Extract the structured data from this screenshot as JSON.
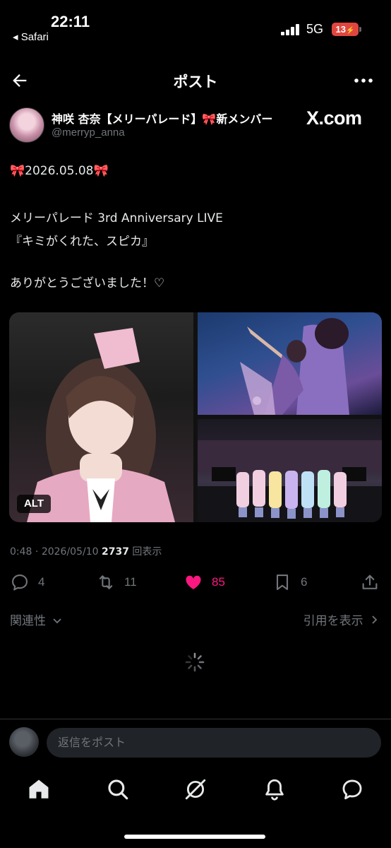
{
  "status": {
    "time": "22:11",
    "back_app": "◂ Safari",
    "network": "5G",
    "battery": "13"
  },
  "header": {
    "title": "ポスト"
  },
  "author": {
    "name": "神咲 杏奈【メリーパレード】🎀新メンバー",
    "handle": "@merryp_anna",
    "source": "X.com"
  },
  "post": {
    "line1": "🎀2026.05.08🎀",
    "line2": "メリーパレード 3rd Anniversary LIVE",
    "line3": "『キミがくれた、スピカ』",
    "line4": "ありがとうございました！♡",
    "alt_badge": "ALT"
  },
  "meta": {
    "time": "0:48",
    "sep": " · ",
    "date": "2026/05/10",
    "views_count": "2737",
    "views_label": " 回表示"
  },
  "actions": {
    "replies": "4",
    "reposts": "11",
    "likes": "85",
    "bookmarks": "6"
  },
  "relevance": {
    "sort_label": "関連性",
    "quotes_label": "引用を表示"
  },
  "reply": {
    "placeholder": "返信をポスト"
  },
  "icons": {
    "back": "arrow-left-icon",
    "more": "more-horizontal-icon",
    "reply": "reply-icon",
    "repost": "repost-icon",
    "like": "heart-icon",
    "bookmark": "bookmark-icon",
    "share": "share-icon",
    "home": "home-icon",
    "search": "search-icon",
    "grok": "grok-icon",
    "notifications": "bell-icon",
    "messages": "messages-icon"
  },
  "colors": {
    "background": "#000000",
    "like": "#f91880",
    "muted": "#71767b",
    "text": "#e7e9ea"
  }
}
